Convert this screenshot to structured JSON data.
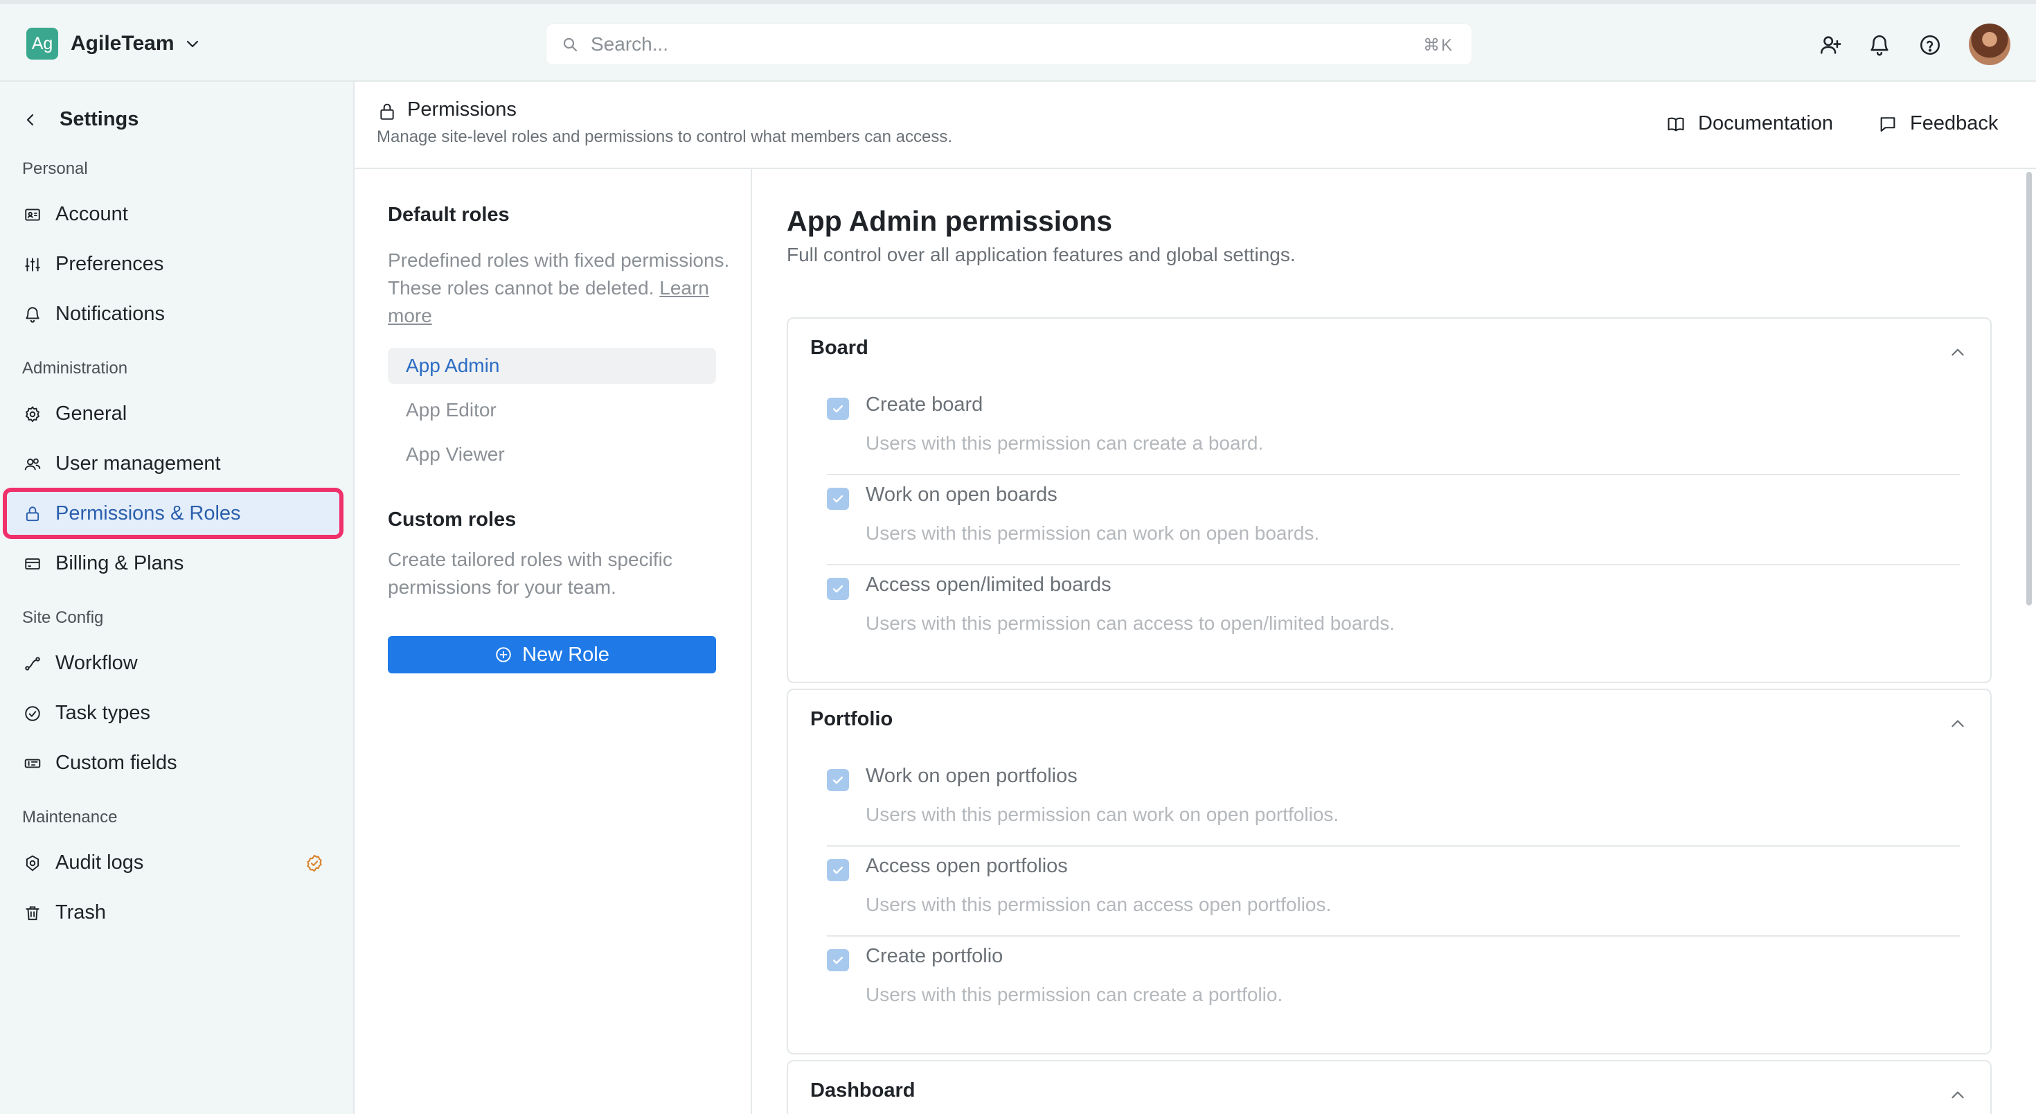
{
  "topbar": {
    "workspace_initials": "Ag",
    "workspace_name": "AgileTeam",
    "search_placeholder": "Search...",
    "search_shortcut": "⌘K",
    "icons": [
      "add-user-icon",
      "bell-icon",
      "help-icon"
    ]
  },
  "sidebar": {
    "title": "Settings",
    "sections": {
      "personal": "Personal",
      "administration": "Administration",
      "site_config": "Site Config",
      "maintenance": "Maintenance"
    },
    "items": {
      "account": "Account",
      "preferences": "Preferences",
      "notifications": "Notifications",
      "general": "General",
      "user_management": "User management",
      "permissions_roles": "Permissions & Roles",
      "billing_plans": "Billing & Plans",
      "workflow": "Workflow",
      "task_types": "Task types",
      "custom_fields": "Custom fields",
      "audit_logs": "Audit logs",
      "trash": "Trash"
    },
    "active": "permissions_roles"
  },
  "page": {
    "title": "Permissions",
    "subtitle": "Manage site-level roles and permissions to control what members can access.",
    "documentation": "Documentation",
    "feedback": "Feedback"
  },
  "roles": {
    "default_heading": "Default roles",
    "default_desc": "Predefined roles with fixed permissions. These roles cannot be deleted.",
    "learn_more": "Learn more",
    "default_items": [
      "App Admin",
      "App Editor",
      "App Viewer"
    ],
    "selected": "App Admin",
    "custom_heading": "Custom roles",
    "custom_desc": "Create tailored roles with specific permissions for your team.",
    "new_role": "New Role"
  },
  "main": {
    "title": "App Admin permissions",
    "subtitle": "Full control over all application features and global settings.",
    "groups": {
      "board": {
        "title": "Board",
        "perms": [
          {
            "title": "Create board",
            "desc": "Users with this permission can create a board.",
            "checked": true
          },
          {
            "title": "Work on open boards",
            "desc": "Users with this permission can work on open boards.",
            "checked": true
          },
          {
            "title": "Access open/limited boards",
            "desc": "Users with this permission can access to open/limited boards.",
            "checked": true
          }
        ]
      },
      "portfolio": {
        "title": "Portfolio",
        "perms": [
          {
            "title": "Work on open portfolios",
            "desc": "Users with this permission can work on open portfolios.",
            "checked": true
          },
          {
            "title": "Access open portfolios",
            "desc": "Users with this permission can access open portfolios.",
            "checked": true
          },
          {
            "title": "Create portfolio",
            "desc": "Users with this permission can create a portfolio.",
            "checked": true
          }
        ]
      },
      "dashboard": {
        "title": "Dashboard"
      }
    }
  },
  "colors": {
    "accent": "#1f7ae8",
    "highlight": "#f0306b",
    "checkbox": "#a8c9ee",
    "chrome_bg": "#f1f6f6"
  }
}
